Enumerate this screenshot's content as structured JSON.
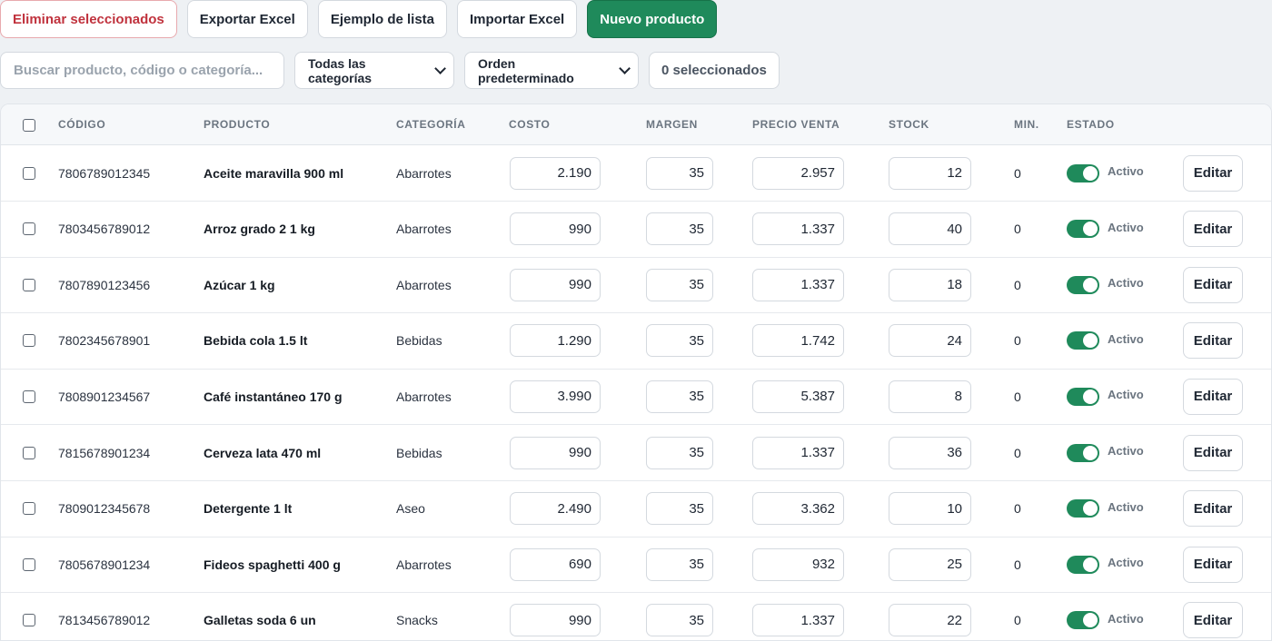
{
  "toolbar": {
    "delete_selected": "Eliminar seleccionados",
    "export_excel": "Exportar Excel",
    "example_list": "Ejemplo de lista",
    "import_excel": "Importar Excel",
    "new_product": "Nuevo producto"
  },
  "filters": {
    "search_placeholder": "Buscar producto, código o categoría...",
    "category_select": "Todas las categorías",
    "order_select": "Orden predeterminado",
    "selected_count": "0 seleccionados"
  },
  "table": {
    "headers": {
      "code": "CÓDIGO",
      "product": "PRODUCTO",
      "category": "CATEGORÍA",
      "cost": "COSTO",
      "margin": "MARGEN",
      "sale_price": "PRECIO VENTA",
      "stock": "STOCK",
      "min": "MIN.",
      "status": "ESTADO"
    },
    "edit_label": "Editar",
    "rows": [
      {
        "code": "7806789012345",
        "product": "Aceite maravilla 900 ml",
        "category": "Abarrotes",
        "cost": "2.190",
        "margin": "35",
        "price": "2.957",
        "stock": "12",
        "min": "0",
        "status": "Activo"
      },
      {
        "code": "7803456789012",
        "product": "Arroz grado 2 1 kg",
        "category": "Abarrotes",
        "cost": "990",
        "margin": "35",
        "price": "1.337",
        "stock": "40",
        "min": "0",
        "status": "Activo"
      },
      {
        "code": "7807890123456",
        "product": "Azúcar 1 kg",
        "category": "Abarrotes",
        "cost": "990",
        "margin": "35",
        "price": "1.337",
        "stock": "18",
        "min": "0",
        "status": "Activo"
      },
      {
        "code": "7802345678901",
        "product": "Bebida cola 1.5 lt",
        "category": "Bebidas",
        "cost": "1.290",
        "margin": "35",
        "price": "1.742",
        "stock": "24",
        "min": "0",
        "status": "Activo"
      },
      {
        "code": "7808901234567",
        "product": "Café instantáneo 170 g",
        "category": "Abarrotes",
        "cost": "3.990",
        "margin": "35",
        "price": "5.387",
        "stock": "8",
        "min": "0",
        "status": "Activo"
      },
      {
        "code": "7815678901234",
        "product": "Cerveza lata 470 ml",
        "category": "Bebidas",
        "cost": "990",
        "margin": "35",
        "price": "1.337",
        "stock": "36",
        "min": "0",
        "status": "Activo"
      },
      {
        "code": "7809012345678",
        "product": "Detergente 1 lt",
        "category": "Aseo",
        "cost": "2.490",
        "margin": "35",
        "price": "3.362",
        "stock": "10",
        "min": "0",
        "status": "Activo"
      },
      {
        "code": "7805678901234",
        "product": "Fideos spaghetti 400 g",
        "category": "Abarrotes",
        "cost": "690",
        "margin": "35",
        "price": "932",
        "stock": "25",
        "min": "0",
        "status": "Activo"
      },
      {
        "code": "7813456789012",
        "product": "Galletas soda 6 un",
        "category": "Snacks",
        "cost": "990",
        "margin": "35",
        "price": "1.337",
        "stock": "22",
        "min": "0",
        "status": "Activo"
      }
    ]
  }
}
